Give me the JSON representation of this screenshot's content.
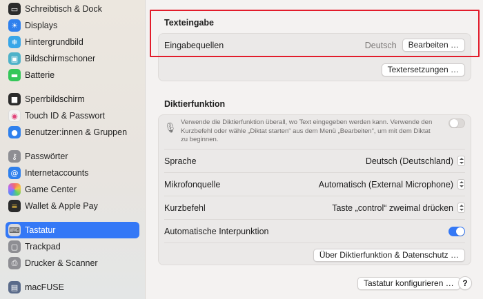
{
  "sidebar": {
    "items": [
      {
        "label": "Schreibtisch & Dock",
        "icon": "dock-icon",
        "color": "#2b2b2b"
      },
      {
        "label": "Displays",
        "icon": "sun-icon",
        "color": "#2f80ed"
      },
      {
        "label": "Hintergrundbild",
        "icon": "snowflake-icon",
        "color": "#39a6e8"
      },
      {
        "label": "Bildschirmschoner",
        "icon": "screensaver-icon",
        "color": "#4fb2c9"
      },
      {
        "label": "Batterie",
        "icon": "battery-icon",
        "color": "#34c759"
      },
      {
        "label": "Sperrbildschirm",
        "icon": "lock-icon",
        "color": "#2b2b2b"
      },
      {
        "label": "Touch ID & Passwort",
        "icon": "fingerprint-icon",
        "color": "#f3f3f3"
      },
      {
        "label": "Benutzer:innen & Gruppen",
        "icon": "users-icon",
        "color": "#2f80ed"
      },
      {
        "label": "Passwörter",
        "icon": "key-icon",
        "color": "#8e8e93"
      },
      {
        "label": "Internetaccounts",
        "icon": "at-icon",
        "color": "#2f80ed"
      },
      {
        "label": "Game Center",
        "icon": "game-center-icon",
        "color": "#f5f5f5"
      },
      {
        "label": "Wallet & Apple Pay",
        "icon": "wallet-icon",
        "color": "#2b2b2b"
      },
      {
        "label": "Tastatur",
        "icon": "keyboard-icon",
        "color": "#8e8e93",
        "selected": true
      },
      {
        "label": "Trackpad",
        "icon": "trackpad-icon",
        "color": "#8e8e93"
      },
      {
        "label": "Drucker & Scanner",
        "icon": "printer-icon",
        "color": "#8e8e93"
      },
      {
        "label": "macFUSE",
        "icon": "macfuse-icon",
        "color": "#5a6b8a"
      }
    ]
  },
  "texteingabe": {
    "title": "Texteingabe",
    "input_sources_label": "Eingabequellen",
    "input_sources_value": "Deutsch",
    "edit_button": "Bearbeiten …",
    "text_replacements_button": "Textersetzungen …"
  },
  "diktier": {
    "title": "Diktierfunktion",
    "description": "Verwende die Diktierfunktion überall, wo Text eingegeben werden kann. Verwende den Kurzbefehl oder wähle „Diktat starten“ aus dem Menü „Bearbeiten“, um mit dem Diktat zu beginnen.",
    "enabled": false,
    "language_label": "Sprache",
    "language_value": "Deutsch (Deutschland)",
    "mic_label": "Mikrofonquelle",
    "mic_value": "Automatisch (External Microphone)",
    "shortcut_label": "Kurzbefehl",
    "shortcut_value": "Taste „control“ zweimal drücken",
    "auto_punct_label": "Automatische Interpunktion",
    "auto_punct_enabled": true,
    "privacy_button": "Über Diktierfunktion & Datenschutz …"
  },
  "footer": {
    "configure_button": "Tastatur konfigurieren …",
    "help_label": "?"
  },
  "colors": {
    "accent": "#3478f6",
    "highlight": "#e21c2b"
  }
}
